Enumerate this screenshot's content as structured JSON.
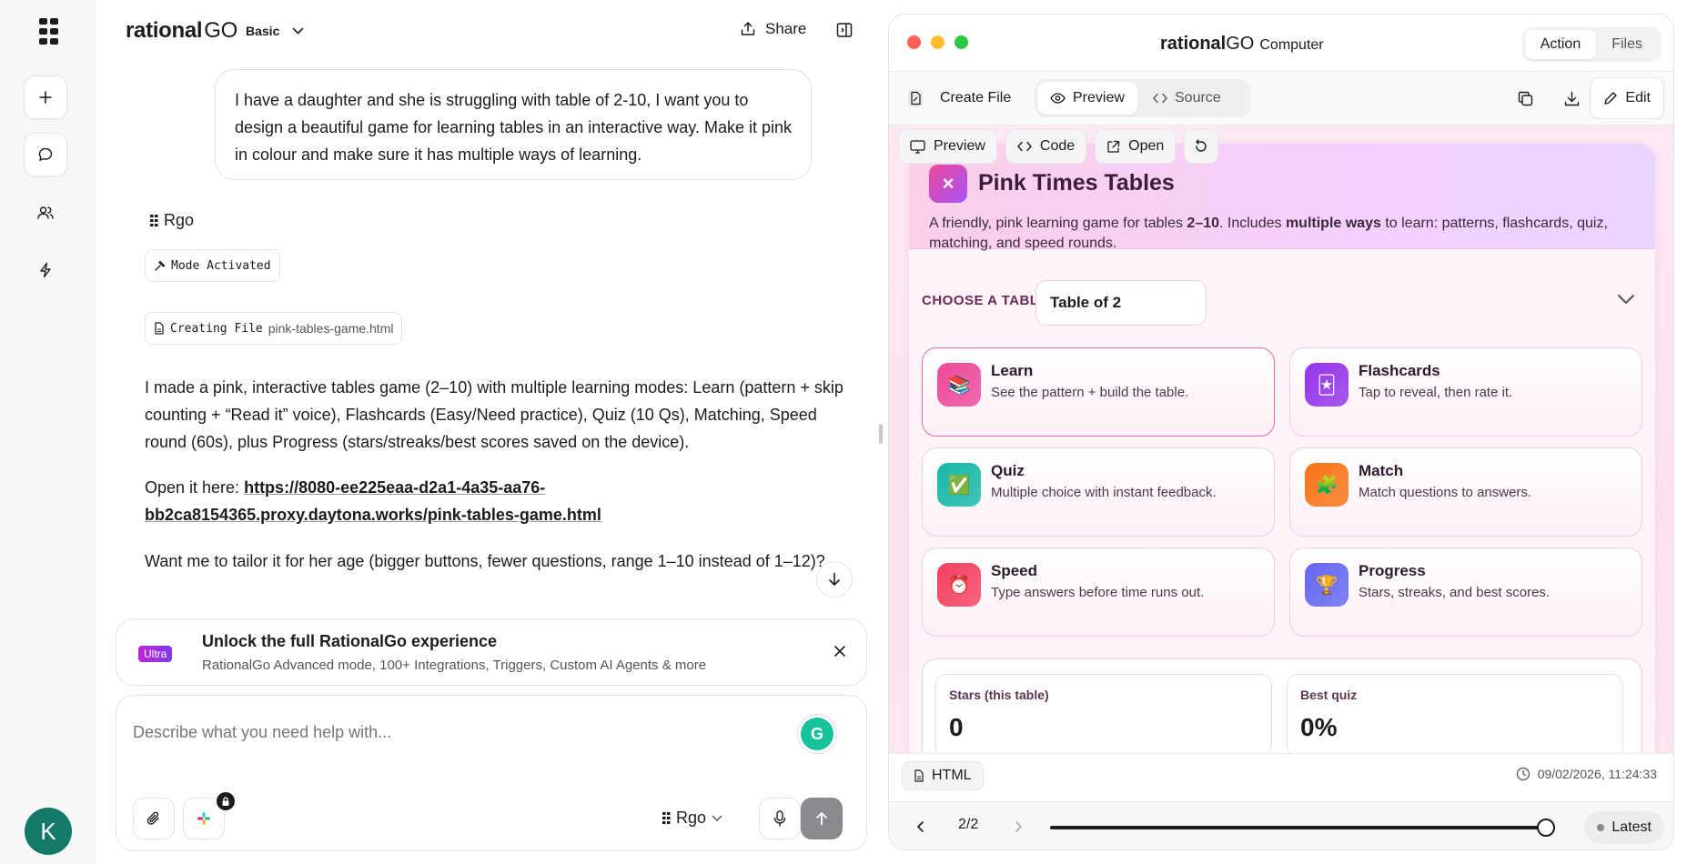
{
  "app": {
    "brand_main": "rational",
    "brand_go": "GO",
    "plan": "Basic"
  },
  "header": {
    "share_label": "Share"
  },
  "sidebar": {
    "avatar_letter": "K"
  },
  "chat": {
    "user_message": "I have a daughter and she is struggling with table of 2-10, I want you to design a beautiful game for learning tables in an interactive way. Make it pink in colour and make sure it has multiple ways of learning.",
    "assistant_name": "Rgo",
    "mode_tag": "Mode Activated",
    "file_tag_label": "Creating File",
    "file_tag_name": "pink-tables-game.html",
    "reply_p1": "I made a pink, interactive tables game (2–10) with multiple learning modes: Learn (pattern + skip counting + “Read it” voice), Flashcards (Easy/Need practice), Quiz (10 Qs), Matching, Speed round (60s), plus Progress (stars/streaks/best scores saved on the device).",
    "reply_p2_prefix": "Open it here: ",
    "reply_link": "https://8080-ee225eaa-d2a1-4a35-aa76-bb2ca8154365.proxy.daytona.works/pink-tables-game.html",
    "reply_p3": "Want me to tailor it for her age (bigger buttons, fewer questions, range 1–10 instead of 1–12)?"
  },
  "upsell": {
    "badge": "Ultra",
    "title": "Unlock the full RationalGo experience",
    "subtitle": "RationalGo Advanced mode, 100+ Integrations, Triggers, Custom AI Agents & more"
  },
  "composer": {
    "placeholder": "Describe what you need help with...",
    "model": "Rgo",
    "grammarly": "G"
  },
  "computer": {
    "title_main": "rational",
    "title_go": "GO",
    "title_suffix": "Computer",
    "tabs": [
      "Action",
      "Files"
    ],
    "toolbar": {
      "create_file": "Create File",
      "preview": "Preview",
      "source": "Source",
      "edit": "Edit"
    },
    "preview_tabs": [
      "Preview",
      "Code",
      "Open"
    ],
    "footer": {
      "file_type": "HTML",
      "timestamp": "09/02/2026, 11:24:33",
      "page": "2/2",
      "latest": "Latest",
      "progress": 1.0
    }
  },
  "game": {
    "logo": "×",
    "title": "Pink Times Tables",
    "desc_a": "A friendly, pink learning game for tables ",
    "desc_b": "2–10",
    "desc_c": ". Includes ",
    "desc_d": "multiple ways",
    "desc_e": " to learn: patterns, flashcards, quiz, matching, and speed rounds.",
    "choose_label": "CHOOSE A TABLE",
    "selected_table": "Table of 2",
    "modes": [
      {
        "title": "Learn",
        "desc": "See the pattern + build the table.",
        "icon": "books-icon",
        "glyph": "📚",
        "color": "#ec4899"
      },
      {
        "title": "Flashcards",
        "desc": "Tap to reveal, then rate it.",
        "icon": "cards-icon",
        "glyph": "🃏",
        "color": "#9333ea"
      },
      {
        "title": "Quiz",
        "desc": "Multiple choice with instant feedback.",
        "icon": "check-icon",
        "glyph": "✅",
        "color": "#14b8a6"
      },
      {
        "title": "Match",
        "desc": "Match questions to answers.",
        "icon": "puzzle-icon",
        "glyph": "🧩",
        "color": "#f97316"
      },
      {
        "title": "Speed",
        "desc": "Type answers before time runs out.",
        "icon": "timer-icon",
        "glyph": "⏰",
        "color": "#f43f5e"
      },
      {
        "title": "Progress",
        "desc": "Stars, streaks, and best scores.",
        "icon": "trophy-icon",
        "glyph": "🏆",
        "color": "#6366f1"
      }
    ],
    "stats": [
      {
        "label": "Stars (this table)",
        "value": "0"
      },
      {
        "label": "Best quiz",
        "value": "0%"
      }
    ]
  }
}
